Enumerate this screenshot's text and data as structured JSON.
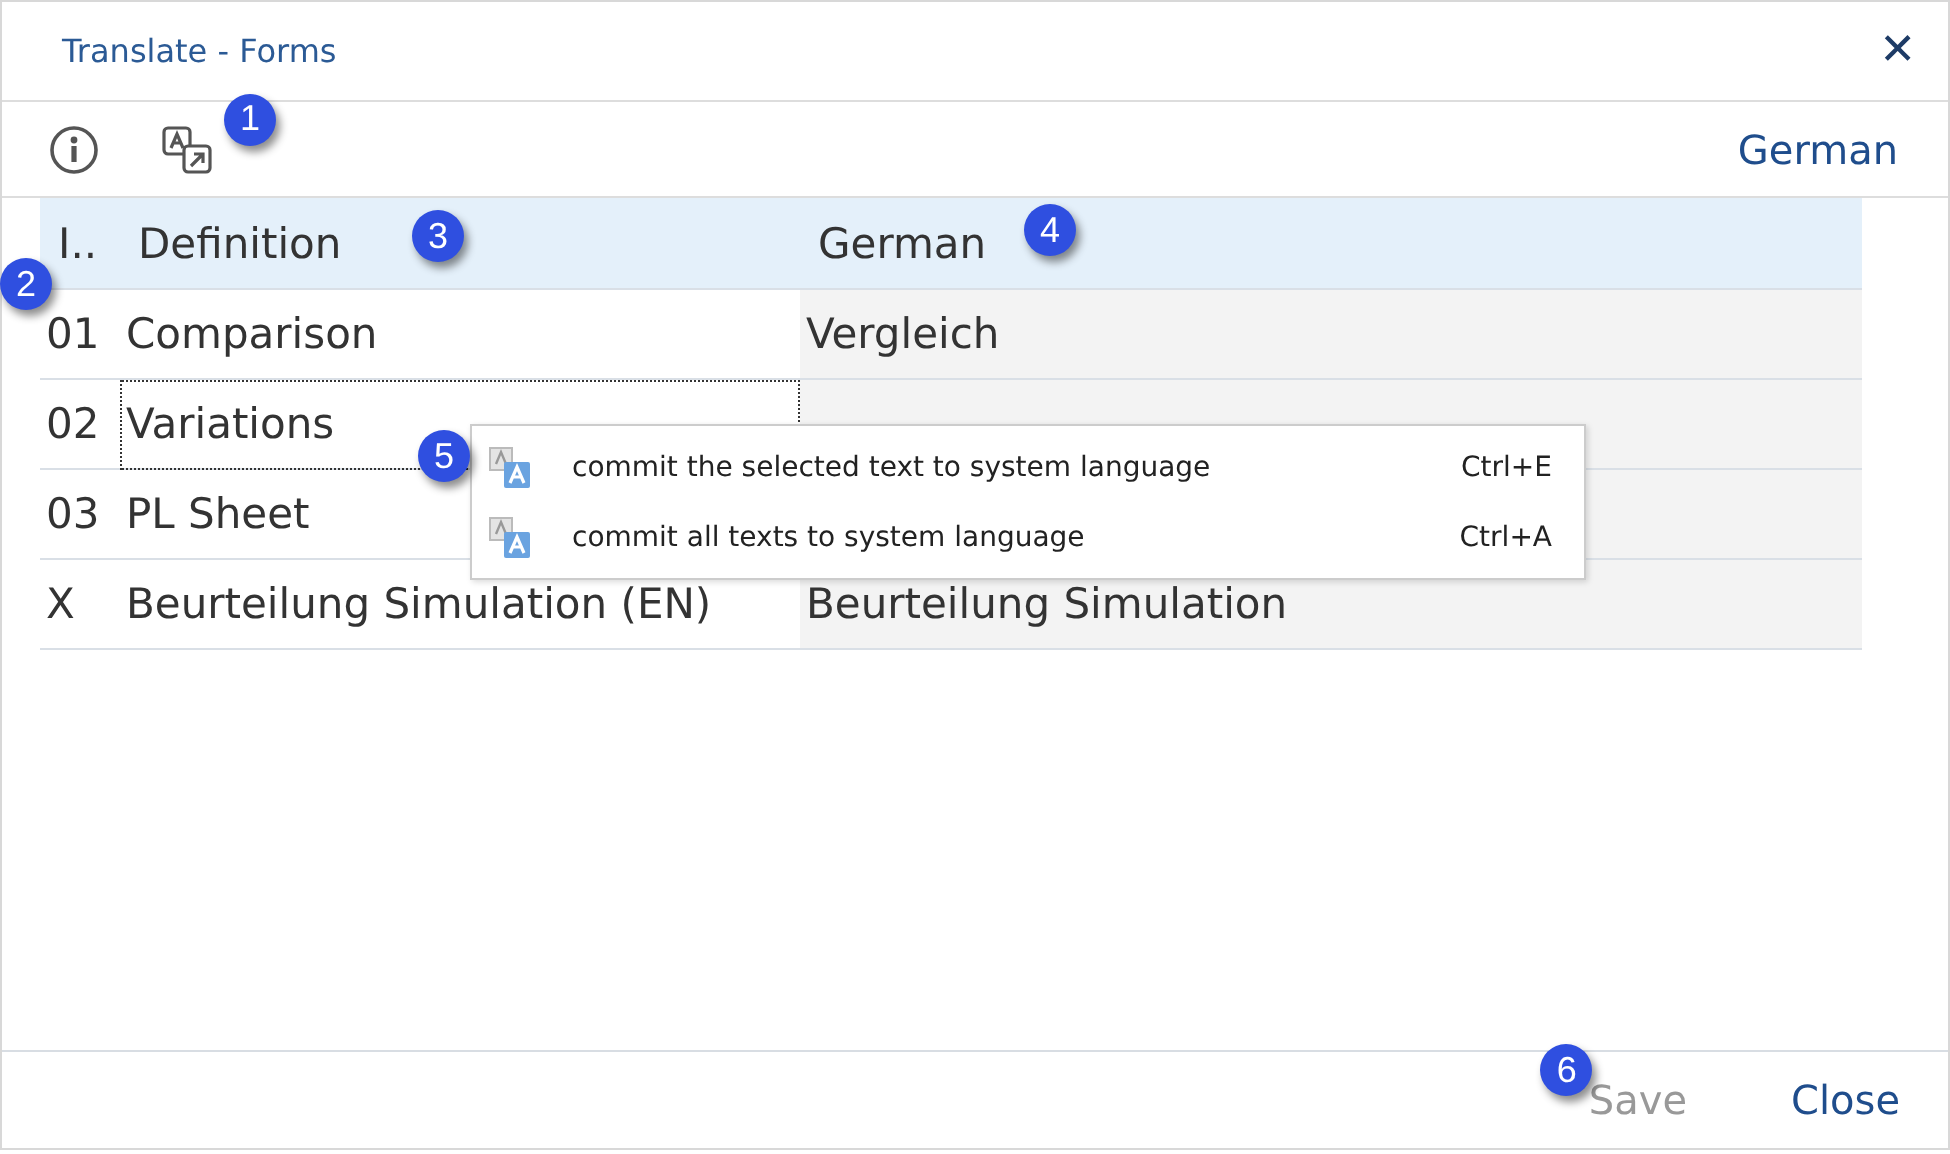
{
  "window": {
    "title": "Translate - Forms",
    "close": "✕"
  },
  "toolbar": {
    "buttons": [
      {
        "kind": "info"
      },
      {
        "kind": "translate",
        "callout": "1"
      }
    ],
    "language": "German"
  },
  "table": {
    "columns": [
      {
        "label": "I..",
        "callout": "2"
      },
      {
        "label": "Definition",
        "callout": "3"
      },
      {
        "label": "German",
        "callout": "4"
      }
    ],
    "rows": [
      {
        "id": "01",
        "definition": "Comparison",
        "german": "Vergleich",
        "selected": false
      },
      {
        "id": "02",
        "definition": "Variations",
        "selected": true
      },
      {
        "id": "03",
        "definition": "PL Sheet",
        "selected": false
      },
      {
        "id": "X",
        "definition": "Beurteilung Simulation (EN)",
        "german": "Beurteilung Simulation",
        "selected": false
      }
    ]
  },
  "context_menu": {
    "callout": "5",
    "items": [
      {
        "label": "commit the selected text to system language",
        "shortcut": "Ctrl+E"
      },
      {
        "label": "commit all texts to system language",
        "shortcut": "Ctrl+A"
      }
    ]
  },
  "footer": {
    "buttons": [
      {
        "label": "Save",
        "disabled": true,
        "callout": "6"
      },
      {
        "label": "Close",
        "disabled": false
      }
    ]
  }
}
